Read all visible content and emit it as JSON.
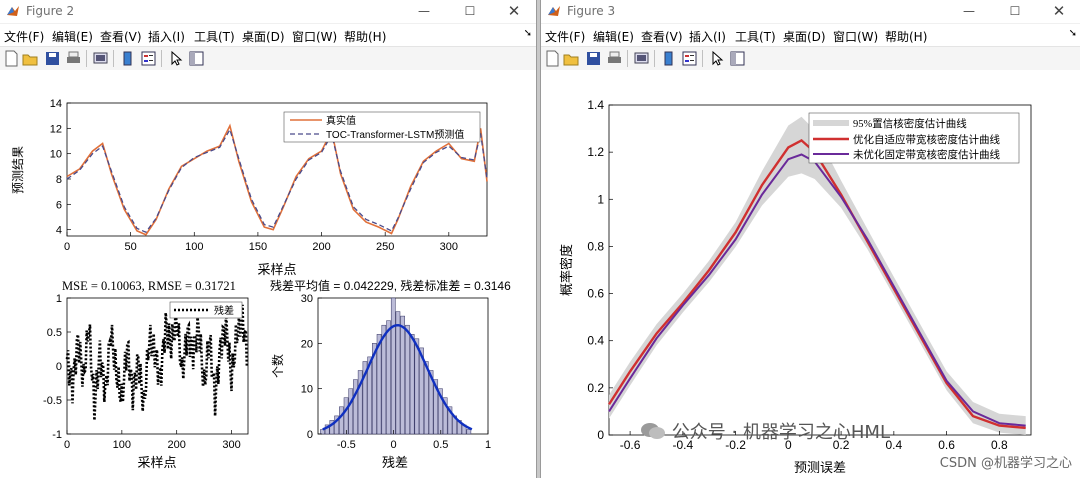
{
  "win2": {
    "title": "Figure 2",
    "menu": [
      "文件(F)",
      "编辑(E)",
      "查看(V)",
      "插入(I)",
      "工具(T)",
      "桌面(D)",
      "窗口(W)",
      "帮助(H)"
    ],
    "top_plot": {
      "ylabel": "预测结果",
      "xlabel": "采样点",
      "xticks": [
        "0",
        "50",
        "100",
        "150",
        "200",
        "250",
        "300"
      ],
      "yticks": [
        "4",
        "6",
        "8",
        "10",
        "12",
        "14"
      ],
      "legend": [
        "真实值",
        "TOC-Transformer-LSTM预测值"
      ]
    },
    "resid_plot": {
      "title": "MSE = 0.10063, RMSE = 0.31721",
      "xlabel": "采样点",
      "xticks": [
        "0",
        "100",
        "200",
        "300"
      ],
      "yticks": [
        "-1",
        "-0.5",
        "0",
        "0.5",
        "1"
      ],
      "legend": "残差"
    },
    "hist_plot": {
      "title": "残差平均值 = 0.042229, 残差标准差 = 0.3146",
      "xlabel": "残差",
      "ylabel": "个数",
      "xticks": [
        "-0.5",
        "0",
        "0.5",
        "1"
      ],
      "yticks": [
        "0",
        "10",
        "20",
        "30"
      ]
    }
  },
  "win3": {
    "title": "Figure 3",
    "menu": [
      "文件(F)",
      "编辑(E)",
      "查看(V)",
      "插入(I)",
      "工具(T)",
      "桌面(D)",
      "窗口(W)",
      "帮助(H)"
    ],
    "plot": {
      "xlabel": "预测误差",
      "ylabel": "概率密度",
      "xticks": [
        "-0.6",
        "-0.4",
        "-0.2",
        "0",
        "0.2",
        "0.4",
        "0.6",
        "0.8"
      ],
      "yticks": [
        "0",
        "0.2",
        "0.4",
        "0.6",
        "0.8",
        "1",
        "1.2",
        "1.4"
      ],
      "legend": [
        "95%置信核密度估计曲线",
        "优化自适应带宽核密度估计曲线",
        "未优化固定带宽核密度估计曲线"
      ]
    }
  },
  "watermark": {
    "main": "公众号 · 机器学习之心HML",
    "csdn": "CSDN @机器学习之心"
  },
  "colors": {
    "real": "#e0703a",
    "pred": "#4a4a8a",
    "resid": "#000000",
    "hist_bar": "#bcbcd8",
    "hist_line": "#1030c0",
    "band": "#d6d6d6",
    "optim": "#d03030",
    "fixed": "#6a2a9a"
  },
  "chart_data": [
    {
      "type": "line",
      "title": "",
      "xlabel": "采样点",
      "ylabel": "预测结果",
      "xlim": [
        0,
        330
      ],
      "ylim": [
        3.5,
        14
      ],
      "series": [
        {
          "name": "真实值",
          "x": [
            0,
            10,
            20,
            28,
            35,
            45,
            55,
            62,
            70,
            80,
            90,
            100,
            110,
            120,
            128,
            135,
            145,
            155,
            162,
            170,
            180,
            190,
            200,
            208,
            215,
            225,
            235,
            245,
            255,
            260,
            270,
            280,
            290,
            300,
            310,
            320,
            325,
            330
          ],
          "y": [
            8.2,
            8.8,
            10.2,
            10.8,
            8.4,
            5.6,
            3.9,
            3.6,
            4.8,
            7.2,
            9.0,
            9.6,
            10.2,
            10.6,
            12.2,
            9.4,
            6.2,
            4.2,
            4.0,
            5.8,
            8.2,
            9.6,
            10.2,
            11.8,
            8.4,
            5.6,
            4.6,
            4.2,
            3.7,
            4.8,
            7.4,
            9.4,
            10.2,
            10.8,
            9.6,
            9.4,
            12.0,
            7.8
          ]
        },
        {
          "name": "TOC-Transformer-LSTM预测值",
          "x": [
            0,
            10,
            20,
            28,
            35,
            45,
            55,
            62,
            70,
            80,
            90,
            100,
            110,
            120,
            128,
            135,
            145,
            155,
            162,
            170,
            180,
            190,
            200,
            208,
            215,
            225,
            235,
            245,
            255,
            260,
            270,
            280,
            290,
            300,
            310,
            320,
            325,
            330
          ],
          "y": [
            8.0,
            8.7,
            10.0,
            10.6,
            8.6,
            5.8,
            4.1,
            3.8,
            4.9,
            7.1,
            8.9,
            9.7,
            10.1,
            10.5,
            11.9,
            9.6,
            6.4,
            4.4,
            4.2,
            5.9,
            8.0,
            9.5,
            10.1,
            11.5,
            8.6,
            5.8,
            4.8,
            4.4,
            3.9,
            4.9,
            7.2,
            9.3,
            10.1,
            10.6,
            9.7,
            9.5,
            11.6,
            8.0
          ]
        }
      ]
    },
    {
      "type": "line",
      "title": "MSE = 0.10063, RMSE = 0.31721",
      "xlabel": "采样点",
      "ylabel": "",
      "xlim": [
        0,
        330
      ],
      "ylim": [
        -1,
        1
      ],
      "series": [
        {
          "name": "残差",
          "x": [
            0,
            10,
            20,
            30,
            40,
            50,
            60,
            70,
            80,
            90,
            100,
            110,
            120,
            130,
            140,
            150,
            160,
            170,
            180,
            190,
            200,
            210,
            220,
            230,
            240,
            250,
            260,
            270,
            280,
            290,
            300,
            310,
            320,
            330
          ],
          "y": [
            0.1,
            -0.3,
            0.4,
            -0.2,
            0.6,
            -0.6,
            0.2,
            -0.4,
            0.5,
            -0.1,
            -0.5,
            0.3,
            -0.4,
            0.1,
            -0.6,
            0.4,
            0.2,
            -0.2,
            0.6,
            0.3,
            0.7,
            -0.1,
            0.5,
            0.2,
            0.6,
            -0.3,
            0.4,
            -0.5,
            0.3,
            0.6,
            -0.2,
            0.5,
            0.7,
            0.1
          ]
        }
      ]
    },
    {
      "type": "bar",
      "title": "残差平均值 = 0.042229, 残差标准差 = 0.3146",
      "xlabel": "残差",
      "ylabel": "个数",
      "xlim": [
        -0.8,
        1
      ],
      "ylim": [
        0,
        30
      ],
      "categories": [
        -0.75,
        -0.7,
        -0.65,
        -0.6,
        -0.55,
        -0.5,
        -0.45,
        -0.4,
        -0.35,
        -0.3,
        -0.25,
        -0.2,
        -0.15,
        -0.1,
        -0.05,
        0,
        0.05,
        0.1,
        0.15,
        0.2,
        0.25,
        0.3,
        0.35,
        0.4,
        0.45,
        0.5,
        0.55,
        0.6,
        0.65,
        0.7,
        0.75,
        0.8
      ],
      "values": [
        1,
        2,
        3,
        4,
        6,
        8,
        10,
        12,
        14,
        16,
        17,
        20,
        22,
        24,
        25,
        30,
        27,
        26,
        24,
        22,
        21,
        19,
        16,
        14,
        12,
        10,
        8,
        6,
        4,
        3,
        2,
        1
      ]
    },
    {
      "type": "line",
      "title": "",
      "xlabel": "预测误差",
      "ylabel": "概率密度",
      "xlim": [
        -0.68,
        0.92
      ],
      "ylim": [
        0,
        1.4
      ],
      "series": [
        {
          "name": "优化自适应带宽核密度估计曲线",
          "x": [
            -0.68,
            -0.6,
            -0.5,
            -0.4,
            -0.3,
            -0.2,
            -0.1,
            0,
            0.05,
            0.1,
            0.2,
            0.3,
            0.4,
            0.5,
            0.6,
            0.7,
            0.8,
            0.9
          ],
          "y": [
            0.13,
            0.27,
            0.43,
            0.56,
            0.7,
            0.86,
            1.06,
            1.22,
            1.25,
            1.2,
            1.02,
            0.82,
            0.62,
            0.42,
            0.22,
            0.08,
            0.04,
            0.03
          ]
        },
        {
          "name": "未优化固定带宽核密度估计曲线",
          "x": [
            -0.68,
            -0.6,
            -0.5,
            -0.4,
            -0.3,
            -0.2,
            -0.1,
            0,
            0.05,
            0.1,
            0.2,
            0.3,
            0.4,
            0.5,
            0.6,
            0.7,
            0.8,
            0.9
          ],
          "y": [
            0.1,
            0.24,
            0.41,
            0.55,
            0.68,
            0.83,
            1.02,
            1.17,
            1.19,
            1.16,
            1.01,
            0.83,
            0.63,
            0.43,
            0.23,
            0.1,
            0.05,
            0.04
          ]
        }
      ]
    }
  ]
}
